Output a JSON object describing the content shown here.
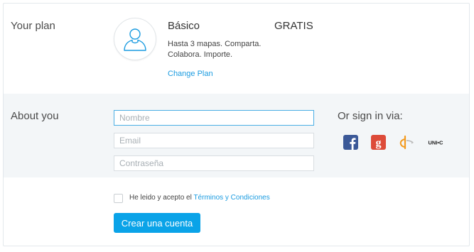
{
  "plan": {
    "section_title": "Your plan",
    "name": "Básico",
    "price": "GRATIS",
    "description": "Hasta 3 mapas. Comparta. Colabora. Importe.",
    "change_link": "Change Plan",
    "avatar_icon": "user-icon"
  },
  "about": {
    "section_title": "About you",
    "fields": {
      "name_placeholder": "Nombre",
      "email_placeholder": "Email",
      "password_placeholder": "Contraseña"
    },
    "signin": {
      "label": "Or sign in via:",
      "providers": [
        {
          "name": "facebook-icon",
          "color": "#3b5998",
          "glyph": "f"
        },
        {
          "name": "google-plus-icon",
          "color": "#dd4b39",
          "glyph": "g"
        },
        {
          "name": "openid-icon",
          "color": "#f39a1e",
          "glyph": "d"
        },
        {
          "name": "unic-icon",
          "color": "#222222",
          "glyph": "UNI•C"
        }
      ]
    }
  },
  "terms": {
    "prefix": "He leido y acepto el",
    "link": "Términos y Condiciones",
    "checked": false
  },
  "submit": {
    "label": "Crear una cuenta"
  },
  "colors": {
    "accent": "#0aa3e8",
    "link": "#1a9be0",
    "section_bg": "#f3f6f8"
  }
}
